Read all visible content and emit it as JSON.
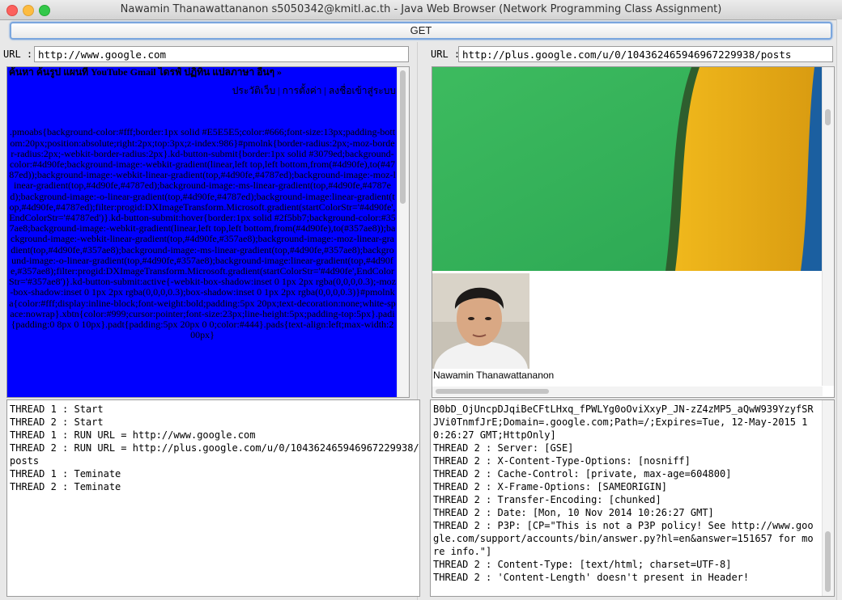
{
  "window": {
    "title": "Nawamin Thanawattananon s5050342@kmitl.ac.th - Java Web Browser (Network Programming Class Assignment)"
  },
  "toolbar": {
    "get_label": "GET"
  },
  "left": {
    "url_label": "URL :",
    "url_value": "http://www.google.com",
    "page_nav": "ค้นหา ค้นรูป แผนที่ YouTube Gmail ไดรฟ์ ปฏิทิน แปลภาษา อื่นๆ »",
    "page_sub": "ประวัติเว็บ | การตั้งค่า | ลงชื่อเข้าสู่ระบบ",
    "page_css": ".pmoabs{background-color:#fff;border:1px solid #E5E5E5;color:#666;font-size:13px;padding-bottom:20px;position:absolute;right:2px;top:3px;z-index:986}#pmolnk{border-radius:2px;-moz-border-radius:2px;-webkit-border-radius:2px}.kd-button-submit{border:1px solid #3079ed;background-color:#4d90fe;background-image:-webkit-gradient(linear,left top,left bottom,from(#4d90fe),to(#4787ed));background-image:-webkit-linear-gradient(top,#4d90fe,#4787ed);background-image:-moz-linear-gradient(top,#4d90fe,#4787ed);background-image:-ms-linear-gradient(top,#4d90fe,#4787ed);background-image:-o-linear-gradient(top,#4d90fe,#4787ed);background-image:linear-gradient(top,#4d90fe,#4787ed);filter:progid:DXImageTransform.Microsoft.gradient(startColorStr='#4d90fe',EndColorStr='#4787ed')}.kd-button-submit:hover{border:1px solid #2f5bb7;background-color:#357ae8;background-image:-webkit-gradient(linear,left top,left bottom,from(#4d90fe),to(#357ae8));background-image:-webkit-linear-gradient(top,#4d90fe,#357ae8);background-image:-moz-linear-gradient(top,#4d90fe,#357ae8);background-image:-ms-linear-gradient(top,#4d90fe,#357ae8);background-image:-o-linear-gradient(top,#4d90fe,#357ae8);background-image:linear-gradient(top,#4d90fe,#357ae8);filter:progid:DXImageTransform.Microsoft.gradient(startColorStr='#4d90fe',EndColorStr='#357ae8')}.kd-button-submit:active{-webkit-box-shadow:inset 0 1px 2px rgba(0,0,0,0.3);-moz-box-shadow:inset 0 1px 2px rgba(0,0,0,0.3);box-shadow:inset 0 1px 2px rgba(0,0,0,0.3)}#pmolnk a{color:#fff;display:inline-block;font-weight:bold;padding:5px 20px;text-decoration:none;white-space:nowrap}.xbtn{color:#999;cursor:pointer;font-size:23px;line-height:5px;padding-top:5px}.padi{padding:0 8px 0 10px}.padt{padding:5px 20px 0 0;color:#444}.pads{text-align:left;max-width:200px}",
    "log": [
      "THREAD 1 : Start",
      "THREAD 2 : Start",
      "THREAD 1 : RUN URL = http://www.google.com",
      "THREAD 2 : RUN URL = http://plus.google.com/u/0/104362465946967229938/posts",
      "THREAD 1 : Teminate",
      "THREAD 2 : Teminate"
    ]
  },
  "right": {
    "url_label": "URL :",
    "url_value": "http://plus.google.com/u/0/104362465946967229938/posts",
    "profile_name": "Nawamin Thanawattananon",
    "log": [
      "B0bD_OjUncpDJqiBeCFtLHxq_fPWLYg0oOviXxyP_JN-zZ4zMP5_aQwW939YzyfSRJVi0TnmfJrE;Domain=.google.com;Path=/;Expires=Tue, 12-May-2015 10:26:27 GMT;HttpOnly]",
      "THREAD 2 : Server: [GSE]",
      "THREAD 2 : X-Content-Type-Options: [nosniff]",
      "THREAD 2 : Cache-Control: [private, max-age=604800]",
      "THREAD 2 : X-Frame-Options: [SAMEORIGIN]",
      "THREAD 2 : Transfer-Encoding: [chunked]",
      "THREAD 2 : Date: [Mon, 10 Nov 2014 10:26:27 GMT]",
      "THREAD 2 : P3P: [CP=\"This is not a P3P policy! See http://www.google.com/support/accounts/bin/answer.py?hl=en&answer=151657 for more info.\"]",
      "THREAD 2 : Content-Type: [text/html; charset=UTF-8]",
      "THREAD 2 : 'Content-Length' doesn't present in Header!"
    ]
  }
}
